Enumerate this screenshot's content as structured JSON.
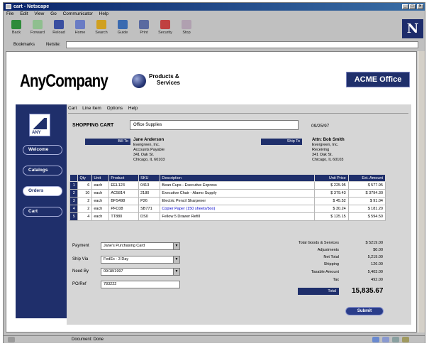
{
  "window": {
    "title": "cart - Netscape",
    "menu": [
      "File",
      "Edit",
      "View",
      "Go",
      "Communicator",
      "Help"
    ]
  },
  "toolbar": {
    "buttons": [
      {
        "label": "Back",
        "icon": "back-arrow-icon",
        "color": "#2e8b3a"
      },
      {
        "label": "Forward",
        "icon": "forward-arrow-icon",
        "color": "#8fbf8f"
      },
      {
        "label": "Reload",
        "icon": "reload-icon",
        "color": "#3a4fa0"
      },
      {
        "label": "Home",
        "icon": "home-icon",
        "color": "#6a7cc4"
      },
      {
        "label": "Search",
        "icon": "search-icon",
        "color": "#d0a020"
      },
      {
        "label": "Guide",
        "icon": "guide-icon",
        "color": "#3a6ab0"
      },
      {
        "label": "Print",
        "icon": "print-icon",
        "color": "#5a6aa0"
      },
      {
        "label": "Security",
        "icon": "security-icon",
        "color": "#c04040"
      },
      {
        "label": "Stop",
        "icon": "stop-icon",
        "color": "#b0a0b0"
      }
    ]
  },
  "location": {
    "bookmarks_label": "Bookmarks",
    "netsite_label": "Netsite:",
    "url": ""
  },
  "header": {
    "company": "AnyCompany",
    "tagline_line1": "Products &",
    "tagline_line2": "Services",
    "badge": "ACME Office"
  },
  "nav": {
    "logo_text": "ANY",
    "items": [
      {
        "label": "Welcome",
        "active": false
      },
      {
        "label": "Catalogs",
        "active": false
      },
      {
        "label": "Orders",
        "active": true
      },
      {
        "label": "Cart",
        "active": false
      }
    ]
  },
  "cart_menu": [
    "Cart",
    "Line Item",
    "Options",
    "Help"
  ],
  "cart": {
    "title": "SHOPPING CART",
    "supplier": "Office Supplies",
    "date": "09/25/97",
    "bill_to_label": "Bill To",
    "bill_to": {
      "name": "Jane Anderson",
      "lines": [
        "Evergreen, Inc.",
        "Accounts Payable",
        "341 Oak St.",
        "Chicago, IL 60103"
      ]
    },
    "ship_to_label": "Ship To",
    "ship_to": {
      "name": "Attn: Bob Smith",
      "lines": [
        "Evergreen, Inc.",
        "Receiving",
        "341 Oak St.",
        "Chicago, IL 60103"
      ]
    }
  },
  "table": {
    "headers": [
      "",
      "Qty",
      "Unit",
      "Product",
      "SKU",
      "Description",
      "Unit Price",
      "Ext. Amount"
    ],
    "rows": [
      {
        "n": "1",
        "qty": "6",
        "unit": "each",
        "product": "EEL123",
        "sku": "0413",
        "desc": "Bean Cups - Executive Express",
        "price": "$ 225.95",
        "ext": "$ 577.95"
      },
      {
        "n": "2",
        "qty": "10",
        "unit": "each",
        "product": "AC5814",
        "sku": "2180",
        "desc": "Executive Chair - Alamo Supply",
        "price": "$ 379.43",
        "ext": "$ 3794.30"
      },
      {
        "n": "3",
        "qty": "2",
        "unit": "each",
        "product": "BFS498",
        "sku": "P26",
        "desc": "Electric Pencil Sharpener",
        "price": "$ 45.52",
        "ext": "$ 91.04"
      },
      {
        "n": "4",
        "qty": "2",
        "unit": "each",
        "product": "PFC08",
        "sku": "SB771",
        "desc": "Copier Paper (150 sheets/box)",
        "price": "$ 30.24",
        "ext": "$ 181.20"
      },
      {
        "n": "5",
        "qty": "4",
        "unit": "each",
        "product": "TT880",
        "sku": "DS0",
        "desc": "Fellow 5 Drawer Refill",
        "price": "$ 125.15",
        "ext": "$ 594.50"
      }
    ]
  },
  "form": {
    "payment_label": "Payment",
    "payment_value": "Jane's Purchasing Card",
    "shipvia_label": "Ship Via",
    "shipvia_value": "FedEx - 3 Day",
    "needby_label": "Need By",
    "needby_value": "09/18/1997",
    "po_label": "PO/Ref",
    "po_value": "783222"
  },
  "totals": {
    "rows": [
      {
        "label": "Total Goods & Services",
        "value": "$ 5219.00"
      },
      {
        "label": "Adjustments",
        "value": "$0.00"
      },
      {
        "label": "Net Total",
        "value": "5,219.00"
      },
      {
        "label": "Shipping",
        "value": "126.00"
      },
      {
        "label": "Taxable Amount",
        "value": "5,403.00"
      },
      {
        "label": "Tax",
        "value": "492.00"
      }
    ],
    "total_label": "Total",
    "total_value": "15,835.67",
    "submit_label": "Submit"
  },
  "status": {
    "text": "Document: Done"
  },
  "colors": {
    "navy": "#1f2f6b",
    "panel": "#d6d6d6"
  }
}
